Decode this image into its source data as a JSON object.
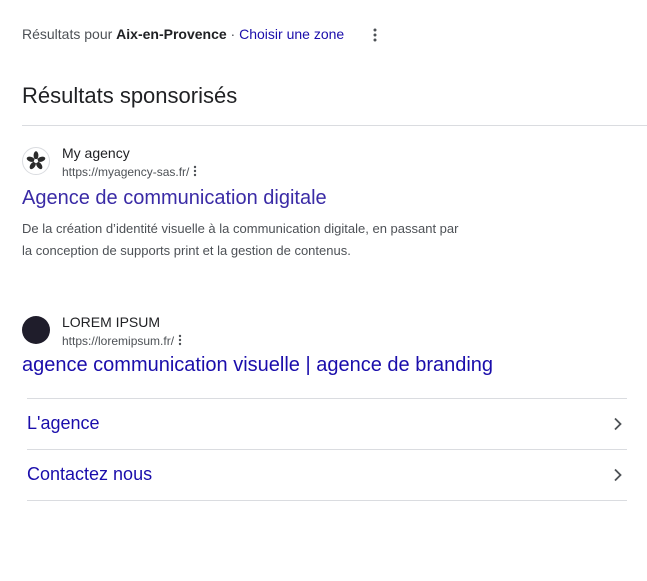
{
  "location": {
    "prefix": "Résultats pour",
    "city": "Aix-en-Provence",
    "separator": "·",
    "choose_zone": "Choisir une zone",
    "menu_icon": "more-vert-icon"
  },
  "sponsored": {
    "title": "Résultats sponsorisés",
    "ads": [
      {
        "site_name": "My agency",
        "url": "https://myagency-sas.fr/",
        "favicon_icon": "flower-logo-icon",
        "headline": "Agence de communication digitale",
        "description_lines": [
          "De la création d’identité visuelle à la communication digitale, en passant par",
          "la conception de supports print et la gestion de contenus."
        ]
      },
      {
        "site_name": "LOREM IPSUM",
        "url": "https://loremipsum.fr/",
        "favicon_icon": "dark-circle-logo-icon",
        "headline": "agence communication visuelle | agence de branding",
        "sitelinks": [
          {
            "label": "L'agence",
            "icon": "chevron-right-icon"
          },
          {
            "label": "Contactez nous",
            "icon": "chevron-right-icon"
          }
        ]
      }
    ]
  },
  "colors": {
    "link": "#1a0dab",
    "visited_link": "#3a2ba6",
    "text": "#202124",
    "secondary_text": "#4d5156",
    "divider": "#dadce0"
  }
}
